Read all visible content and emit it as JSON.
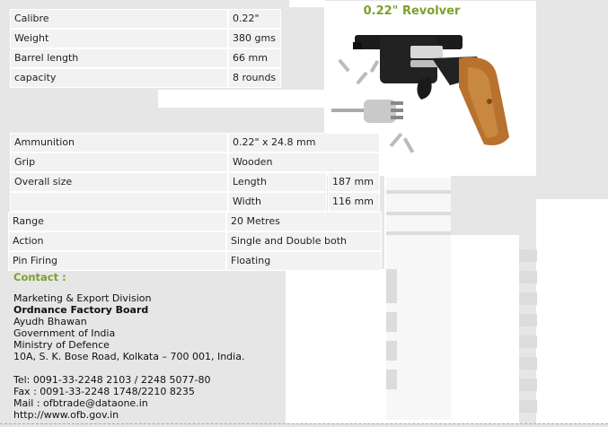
{
  "spec_table_1": [
    {
      "label": "Calibre",
      "value": "0.22\""
    },
    {
      "label": "Weight",
      "value": "380 gms"
    },
    {
      "label": "Barrel length",
      "value": "66 mm"
    },
    {
      "label": "capacity",
      "value": "8 rounds"
    }
  ],
  "product": {
    "title": "0.22\" Revolver",
    "image_icon": "revolver-photo"
  },
  "spec_table_2": {
    "ammunition": {
      "label": "Ammunition",
      "value": "0.22\" x 24.8 mm"
    },
    "grip": {
      "label": "Grip",
      "value": "Wooden"
    },
    "overall_size": {
      "label": "Overall size",
      "length_label": "Length",
      "length_value": "187 mm",
      "width_label": "Width",
      "width_value": "116 mm"
    },
    "range": {
      "label": "Range",
      "value": "20 Metres"
    },
    "action": {
      "label": "Action",
      "value": "Single and Double both"
    },
    "pin_firing": {
      "label": "Pin Firing",
      "value": "Floating"
    }
  },
  "contact": {
    "heading": "Contact :",
    "division": "Marketing & Export Division",
    "org": "Ordnance Factory Board",
    "building": "Ayudh Bhawan",
    "gov": "Government of India",
    "ministry": "Ministry of Defence",
    "address": "10A, S. K. Bose Road, Kolkata – 700 001, India.",
    "tel": "Tel: 0091-33-2248 2103 / 2248 5077-80",
    "fax": "Fax : 0091-33-2248 1748/2210 8235",
    "mail": "Mail : ofbtrade@dataone.in",
    "url": "http://www.ofb.gov.in"
  },
  "colors": {
    "accent": "#7aa12c",
    "cell_bg": "#f2f2f2",
    "page_bg": "#e6e6e6"
  }
}
